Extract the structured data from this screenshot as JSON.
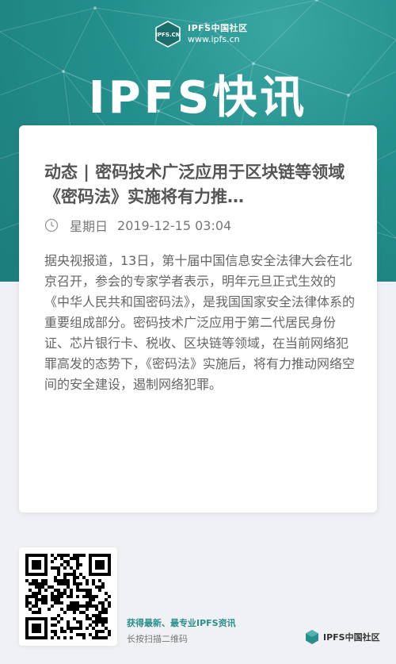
{
  "header": {
    "brand_logo_text": "IPFS.CN",
    "brand_name": "IPFS中国社区",
    "brand_url": "www.ipfs.cn",
    "hero_title": "IPFS快讯"
  },
  "article": {
    "title": "动态 | 密码技术广泛应用于区块链等领域 《密码法》实施将有力推…",
    "weekday": "星期日",
    "datetime": "2019-12-15 03:04",
    "body": "据央视报道，13日，第十届中国信息安全法律大会在北京召开，参会的专家学者表示，明年元旦正式生效的《中华人民共和国密码法》，是我国国家安全法律体系的重要组成部分。密码技术广泛应用于第二代居民身份证、芯片银行卡、税收、区块链等领域，在当前网络犯罪高发的态势下，《密码法》实施后，将有力推动网络空间的安全建设，遏制网络犯罪。"
  },
  "footer": {
    "tagline": "获得最新、最专业IPFS资讯",
    "hint": "长按扫描二维码",
    "logo_text": "IPFS中国社区"
  },
  "colors": {
    "brand_teal": "#238f8c",
    "page_bg": "#f0f1f5"
  }
}
